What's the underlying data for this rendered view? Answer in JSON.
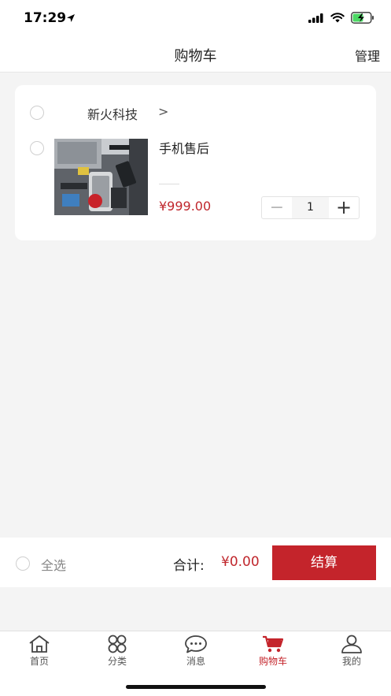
{
  "status_bar": {
    "time": "17:29"
  },
  "nav": {
    "title": "购物车",
    "manage_label": "管理"
  },
  "cart": {
    "shop_name": "新火科技",
    "shop_arrow": ">",
    "item": {
      "title": "手机售后",
      "price": "¥999.00",
      "quantity": "1",
      "minus_symbol": "−",
      "plus_symbol": "+"
    }
  },
  "checkout": {
    "select_all_label": "全选",
    "total_label": "合计:",
    "total_value": "¥0.00",
    "checkout_label": "结算"
  },
  "tabs": [
    {
      "label": "首页",
      "icon": "home-icon",
      "active": false
    },
    {
      "label": "分类",
      "icon": "category-icon",
      "active": false
    },
    {
      "label": "消息",
      "icon": "message-icon",
      "active": false
    },
    {
      "label": "购物车",
      "icon": "cart-icon",
      "active": true
    },
    {
      "label": "我的",
      "icon": "user-icon",
      "active": false
    }
  ],
  "colors": {
    "accent": "#c4242b",
    "price": "#c0272d",
    "background": "#f4f4f4"
  }
}
